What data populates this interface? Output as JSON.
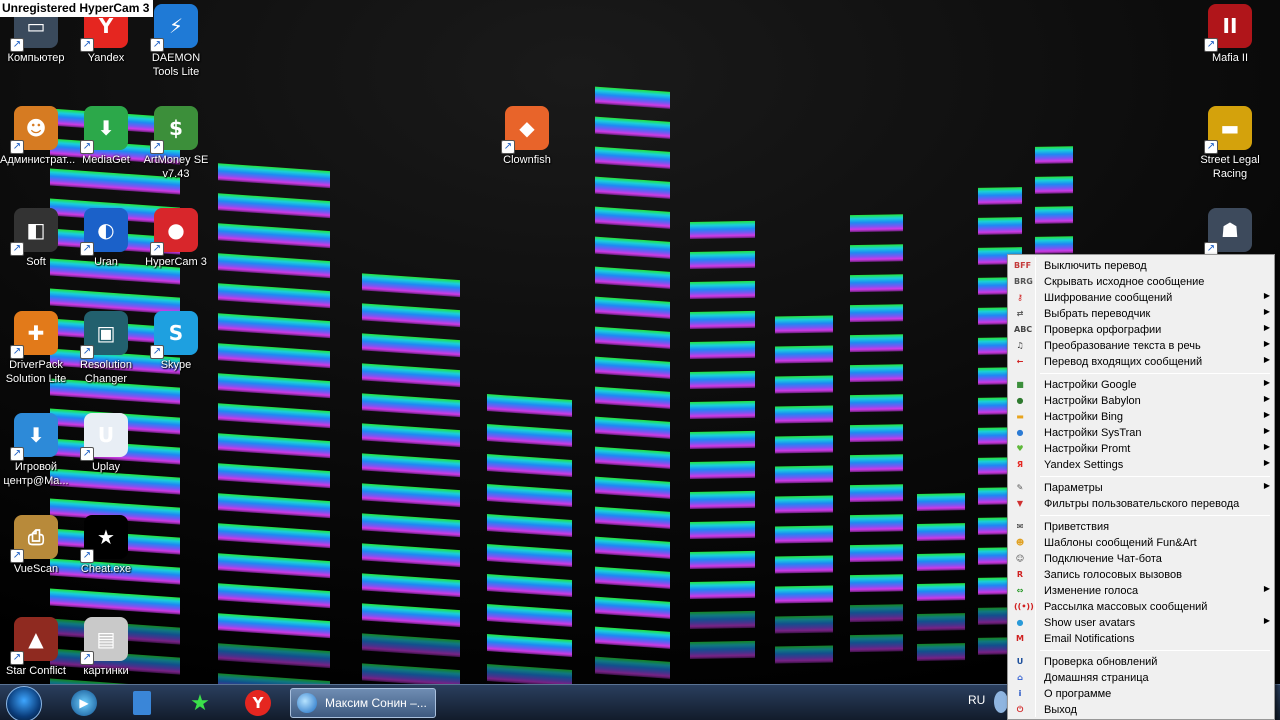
{
  "watermark": "Unregistered HyperCam 3",
  "desktop": {
    "icons": [
      {
        "label": "Компьютер",
        "icon": "computer-icon",
        "color": "#3a4a5c",
        "glyph": "▭"
      },
      {
        "label": "Yandex",
        "icon": "yandex-icon",
        "color": "#e52620",
        "glyph": "Y"
      },
      {
        "label": "DAEMON Tools Lite",
        "icon": "daemon-tools-icon",
        "color": "#1f7ad6",
        "glyph": "⚡"
      },
      {
        "label": "Mafia II",
        "icon": "mafia-icon",
        "color": "#b0151a",
        "glyph": "II"
      },
      {
        "label": "Администрат...",
        "icon": "administrator-icon",
        "color": "#d67b22",
        "glyph": "☻"
      },
      {
        "label": "MediaGet",
        "icon": "mediaget-icon",
        "color": "#2ca84a",
        "glyph": "⬇"
      },
      {
        "label": "ArtMoney SE v7.43",
        "icon": "artmoney-icon",
        "color": "#3c8f3a",
        "glyph": "$"
      },
      {
        "label": "Clownfish",
        "icon": "clownfish-icon",
        "color": "#e8642a",
        "glyph": "◆"
      },
      {
        "label": "Street Legal Racing",
        "icon": "street-legal-racing-icon",
        "color": "#d4a20c",
        "glyph": "▬"
      },
      {
        "label": "Soft",
        "icon": "soft-folder-icon",
        "color": "#333333",
        "glyph": "◧"
      },
      {
        "label": "Uran",
        "icon": "uran-icon",
        "color": "#1b61c9",
        "glyph": "◐"
      },
      {
        "label": "HyperCam 3",
        "icon": "hypercam-icon",
        "color": "#d8262b",
        "glyph": "●"
      },
      {
        "label": "DriverPack Solution Lite",
        "icon": "driverpack-icon",
        "color": "#e27a1a",
        "glyph": "✚"
      },
      {
        "label": "Resolution Changer",
        "icon": "resolution-changer-icon",
        "color": "#22606e",
        "glyph": "▣"
      },
      {
        "label": "Skype",
        "icon": "skype-icon",
        "color": "#1ea0e0",
        "glyph": "S"
      },
      {
        "label": "Игровой центр@Ma...",
        "icon": "game-center-icon",
        "color": "#2d8ad8",
        "glyph": "⬇"
      },
      {
        "label": "Uplay",
        "icon": "uplay-icon",
        "color": "#e8eef5",
        "glyph": "U"
      },
      {
        "label": "VueScan",
        "icon": "vuescan-icon",
        "color": "#b88a3a",
        "glyph": "⎙"
      },
      {
        "label": "Cheat.exe",
        "icon": "cheat-exe-icon",
        "color": "#000000",
        "glyph": "★"
      },
      {
        "label": "Star Conflict",
        "icon": "star-conflict-icon",
        "color": "#8f2a20",
        "glyph": "▲"
      },
      {
        "label": "картинки",
        "icon": "pictures-folder-icon",
        "color": "#c9c9c9",
        "glyph": "▤"
      }
    ]
  },
  "taskbar": {
    "active_window_label": "Максим Сонин –...",
    "language": "RU"
  },
  "menu": {
    "groups": [
      [
        {
          "label": "Выключить перевод",
          "icon": "disable-translation-icon",
          "icon_text": "BFF",
          "color": "#c43b3b",
          "submenu": false
        },
        {
          "label": "Скрывать исходное сообщение",
          "icon": "hide-original-icon",
          "icon_text": "BRG",
          "color": "#555555",
          "submenu": false
        },
        {
          "label": "Шифрование сообщений",
          "icon": "encryption-key-icon",
          "icon_text": "⚷",
          "color": "#d02020",
          "submenu": true
        },
        {
          "label": "Выбрать переводчик",
          "icon": "choose-translator-icon",
          "icon_text": "⇄",
          "color": "#555555",
          "submenu": true
        },
        {
          "label": "Проверка орфографии",
          "icon": "spellcheck-icon",
          "icon_text": "ABC",
          "color": "#444444",
          "submenu": true
        },
        {
          "label": "Преобразование текста в речь",
          "icon": "text-to-speech-icon",
          "icon_text": "♫",
          "color": "#333333",
          "submenu": true
        },
        {
          "label": "Перевод входящих сообщений",
          "icon": "incoming-translation-icon",
          "icon_text": "←",
          "color": "#d02020",
          "submenu": true
        }
      ],
      [
        {
          "label": "Настройки Google",
          "icon": "google-icon",
          "icon_text": "■",
          "color": "#3b8f3b",
          "submenu": true
        },
        {
          "label": "Настройки Babylon",
          "icon": "babylon-icon",
          "icon_text": "●",
          "color": "#2f7a2f",
          "submenu": true
        },
        {
          "label": "Настройки Bing",
          "icon": "bing-icon",
          "icon_text": "▬",
          "color": "#e8a41e",
          "submenu": true
        },
        {
          "label": "Настройки SysTran",
          "icon": "systran-icon",
          "icon_text": "●",
          "color": "#2c7bd4",
          "submenu": true
        },
        {
          "label": "Настройки Promt",
          "icon": "promt-icon",
          "icon_text": "♥",
          "color": "#5fb83a",
          "submenu": true
        },
        {
          "label": "Yandex Settings",
          "icon": "yandex-settings-icon",
          "icon_text": "Я",
          "color": "#e52620",
          "submenu": true
        }
      ],
      [
        {
          "label": "Параметры",
          "icon": "parameters-wrench-icon",
          "icon_text": "✎",
          "color": "#555555",
          "submenu": true
        },
        {
          "label": "Фильтры пользовательского перевода",
          "icon": "filter-icon",
          "icon_text": "▼",
          "color": "#d03030",
          "submenu": false
        }
      ],
      [
        {
          "label": "Приветствия",
          "icon": "greetings-envelope-icon",
          "icon_text": "✉",
          "color": "#222222",
          "submenu": false
        },
        {
          "label": "Шаблоны сообщений Fun&Art",
          "icon": "funart-smiley-icon",
          "icon_text": "☻",
          "color": "#e0a020",
          "submenu": false
        },
        {
          "label": "Подключение Чат-бота",
          "icon": "chatbot-icon",
          "icon_text": "☺",
          "color": "#444444",
          "submenu": false
        },
        {
          "label": "Запись голосовых вызовов",
          "icon": "record-calls-icon",
          "icon_text": "R",
          "color": "#d02020",
          "submenu": false
        },
        {
          "label": "Изменение голоса",
          "icon": "voice-change-icon",
          "icon_text": "⇔",
          "color": "#2a9a2a",
          "submenu": true
        },
        {
          "label": "Рассылка массовых сообщений",
          "icon": "broadcast-icon",
          "icon_text": "((•))",
          "color": "#d02020",
          "submenu": false
        },
        {
          "label": "Show user avatars",
          "icon": "avatars-icon",
          "icon_text": "●",
          "color": "#2a9ad8",
          "submenu": true
        },
        {
          "label": "Email Notifications",
          "icon": "email-icon",
          "icon_text": "M",
          "color": "#d02020",
          "submenu": false
        }
      ],
      [
        {
          "label": "Проверка обновлений",
          "icon": "updates-icon",
          "icon_text": "U",
          "color": "#1d4f9c",
          "submenu": false
        },
        {
          "label": "Домашняя страница",
          "icon": "home-page-icon",
          "icon_text": "⌂",
          "color": "#2a5ad0",
          "submenu": false
        },
        {
          "label": "О программе",
          "icon": "about-icon",
          "icon_text": "i",
          "color": "#1d4fc4",
          "submenu": false
        },
        {
          "label": "Выход",
          "icon": "exit-icon",
          "icon_text": "⏻",
          "color": "#d02020",
          "submenu": false
        }
      ]
    ]
  }
}
